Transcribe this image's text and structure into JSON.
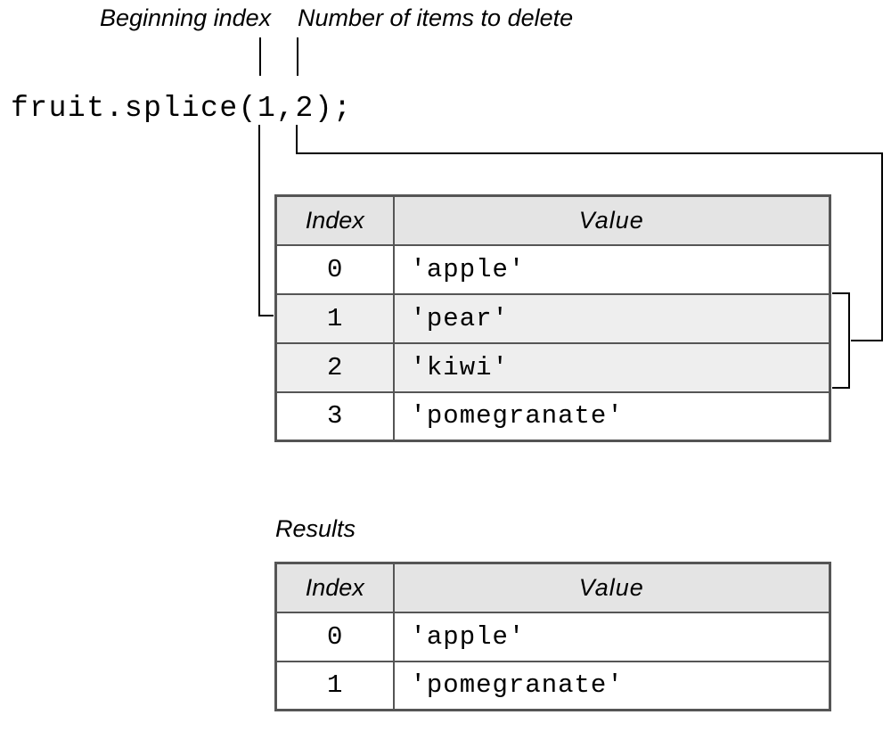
{
  "labels": {
    "beginning_index": "Beginning index",
    "number_to_delete": "Number of items to delete",
    "results": "Results"
  },
  "code": {
    "full": "fruit.splice(1,2);",
    "arg1": "1",
    "arg2": "2"
  },
  "table1": {
    "headers": {
      "index": "Index",
      "value": "Value"
    },
    "rows": [
      {
        "index": "0",
        "value": "'apple'",
        "highlighted": false
      },
      {
        "index": "1",
        "value": "'pear'",
        "highlighted": true
      },
      {
        "index": "2",
        "value": "'kiwi'",
        "highlighted": true
      },
      {
        "index": "3",
        "value": "'pomegranate'",
        "highlighted": false
      }
    ]
  },
  "table2": {
    "headers": {
      "index": "Index",
      "value": "Value"
    },
    "rows": [
      {
        "index": "0",
        "value": "'apple'"
      },
      {
        "index": "1",
        "value": "'pomegranate'"
      }
    ]
  }
}
